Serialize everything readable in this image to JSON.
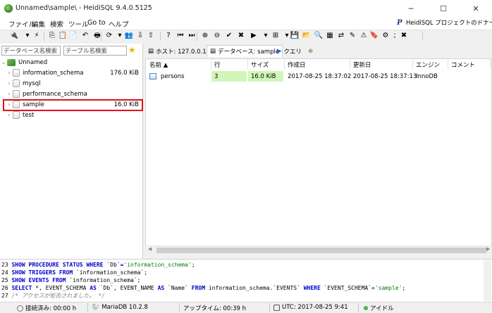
{
  "window": {
    "title": "Unnamed\\sample\\ - HeidiSQL 9.4.0.5125",
    "minimize_glyph": "─",
    "maximize_glyph": "☐",
    "close_glyph": "✕"
  },
  "menu": {
    "items": [
      "ファイル",
      "編集",
      "検索",
      "ツール",
      "Go to",
      "ヘルプ"
    ],
    "donate_label": "HeidiSQL プロジェクトのドナーになる",
    "donate_icon_glyph": "P"
  },
  "toolbar": {
    "buttons": [
      {
        "icon": "connect-icon",
        "glyph": "🔌"
      },
      {
        "icon": "dropdown-icon",
        "glyph": "▾"
      },
      {
        "icon": "disconnect-icon",
        "glyph": "⚡"
      },
      {
        "icon": "copy-icon",
        "glyph": "⎘"
      },
      {
        "icon": "paste-icon",
        "glyph": "📋"
      },
      {
        "icon": "cut-icon",
        "glyph": "📄"
      },
      {
        "icon": "undo-icon",
        "glyph": "↶"
      },
      {
        "icon": "print-icon",
        "glyph": "🖶"
      },
      {
        "icon": "refresh-icon",
        "glyph": "⟳"
      },
      {
        "icon": "dropdown-icon",
        "glyph": "▾"
      },
      {
        "icon": "user-manager-icon",
        "glyph": "👥"
      },
      {
        "icon": "import-icon",
        "glyph": "⇩"
      },
      {
        "icon": "export-icon",
        "glyph": "⇧"
      },
      {
        "icon": "help-icon",
        "glyph": "?"
      },
      {
        "icon": "first-icon",
        "glyph": "⏮"
      },
      {
        "icon": "last-icon",
        "glyph": "⏭"
      },
      {
        "icon": "insert-icon",
        "glyph": "⊕"
      },
      {
        "icon": "delete-icon",
        "glyph": "⊖"
      },
      {
        "icon": "post-icon",
        "glyph": "✔"
      },
      {
        "icon": "cancel-icon",
        "glyph": "✖"
      },
      {
        "icon": "run-icon",
        "glyph": "▶"
      },
      {
        "icon": "dropdown-icon",
        "glyph": "▾"
      },
      {
        "icon": "explain-icon",
        "glyph": "⊞"
      },
      {
        "icon": "dropdown-icon",
        "glyph": "▾"
      },
      {
        "icon": "save-icon",
        "glyph": "💾"
      },
      {
        "icon": "open-icon",
        "glyph": "📂"
      },
      {
        "icon": "find-icon",
        "glyph": "🔍"
      },
      {
        "icon": "filter-icon",
        "glyph": "▦"
      },
      {
        "icon": "replace-icon",
        "glyph": "⇄"
      },
      {
        "icon": "edit-icon",
        "glyph": "✎"
      },
      {
        "icon": "warning-icon",
        "glyph": "⚠"
      },
      {
        "icon": "bookmark-icon",
        "glyph": "🔖"
      },
      {
        "icon": "settings-icon",
        "glyph": "⚙"
      },
      {
        "icon": "semicolon-icon",
        "glyph": ";"
      },
      {
        "icon": "stop-icon",
        "glyph": "✖"
      }
    ]
  },
  "left_panel": {
    "filter_db_placeholder": "データベース名検索",
    "filter_table_placeholder": "テーブル名検索",
    "star_glyph": "★",
    "tree": {
      "root_label": "Unnamed",
      "root_expanded_glyph": "⌄",
      "collapsed_glyph": "›",
      "databases": [
        {
          "name": "information_schema",
          "size": "176.0 KiB"
        },
        {
          "name": "mysql",
          "size": ""
        },
        {
          "name": "performance_schema",
          "size": ""
        },
        {
          "name": "sample",
          "size": "16.0 KiB"
        },
        {
          "name": "test",
          "size": ""
        }
      ]
    }
  },
  "tabs": [
    {
      "label": "ホスト: 127.0.0.1",
      "glyph": "▤"
    },
    {
      "label": "データベース: sample",
      "glyph": "▤"
    },
    {
      "label": "クエリ",
      "glyph": "▶"
    },
    {
      "label": "",
      "glyph": "⊕"
    }
  ],
  "table": {
    "columns": [
      "名前 ▲",
      "行",
      "サイズ",
      "作成日",
      "更新日",
      "エンジン",
      "コメント"
    ],
    "rows": [
      [
        "persons",
        "3",
        "16.0 KiB",
        "2017-08-25 18:37:02",
        "2017-08-25 18:37:13",
        "InnoDB",
        ""
      ]
    ]
  },
  "sql_log": {
    "lines": [
      {
        "num": "23",
        "tokens": [
          [
            "kw",
            "SHOW PROCEDURE STATUS WHERE "
          ],
          [
            "plain",
            "`Db`"
          ],
          [
            "kw",
            "="
          ],
          [
            "str",
            "'information_schema'"
          ],
          [
            "plain",
            ";"
          ]
        ]
      },
      {
        "num": "24",
        "tokens": [
          [
            "kw",
            "SHOW TRIGGERS FROM "
          ],
          [
            "plain",
            "`information_schema`"
          ],
          [
            "plain",
            ";"
          ]
        ]
      },
      {
        "num": "25",
        "tokens": [
          [
            "kw",
            "SHOW EVENTS FROM "
          ],
          [
            "plain",
            "`information_schema`"
          ],
          [
            "plain",
            ";"
          ]
        ]
      },
      {
        "num": "26",
        "tokens": [
          [
            "kw",
            "SELECT "
          ],
          [
            "plain",
            "*, EVENT_SCHEMA "
          ],
          [
            "kw",
            "AS "
          ],
          [
            "plain",
            "`Db`, EVENT_NAME "
          ],
          [
            "kw",
            "AS "
          ],
          [
            "plain",
            "`Name` "
          ],
          [
            "kw",
            "FROM "
          ],
          [
            "plain",
            "information_schema.`EVENTS` "
          ],
          [
            "kw",
            "WHERE "
          ],
          [
            "plain",
            "`EVENT_SCHEMA`="
          ],
          [
            "str",
            "'sample'"
          ],
          [
            "plain",
            ";"
          ]
        ]
      },
      {
        "num": "27",
        "tokens": [
          [
            "cmt",
            "/* アクセスが拒否されました。 */"
          ]
        ]
      }
    ]
  },
  "status_bar": {
    "connected": "接続済み: 00:00 h",
    "server": "MariaDB 10.2.8",
    "uptime": "アップタイム: 00:39 h",
    "utc": "UTC: 2017-08-25 9:41",
    "state": "アイドル"
  }
}
